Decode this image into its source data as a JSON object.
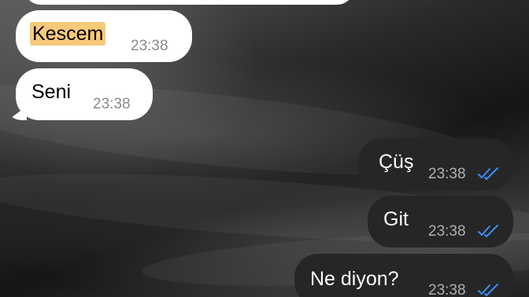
{
  "chat": {
    "incoming": [
      {
        "text": "Kescem",
        "time": "23:38",
        "highlighted": true
      },
      {
        "text": "Seni",
        "time": "23:38",
        "highlighted": false
      }
    ],
    "outgoing": [
      {
        "text": "Çüş",
        "time": "23:38",
        "status_icon": "double-check-icon"
      },
      {
        "text": "Git",
        "time": "23:38",
        "status_icon": "double-check-icon"
      },
      {
        "text": "Ne diyon?",
        "time": "23:38",
        "status_icon": "double-check-icon"
      }
    ]
  },
  "colors": {
    "incoming_bubble": "#ffffff",
    "outgoing_bubble": "#262626",
    "highlight": "#f7c97a",
    "read_ticks": "#3a8dfc"
  }
}
